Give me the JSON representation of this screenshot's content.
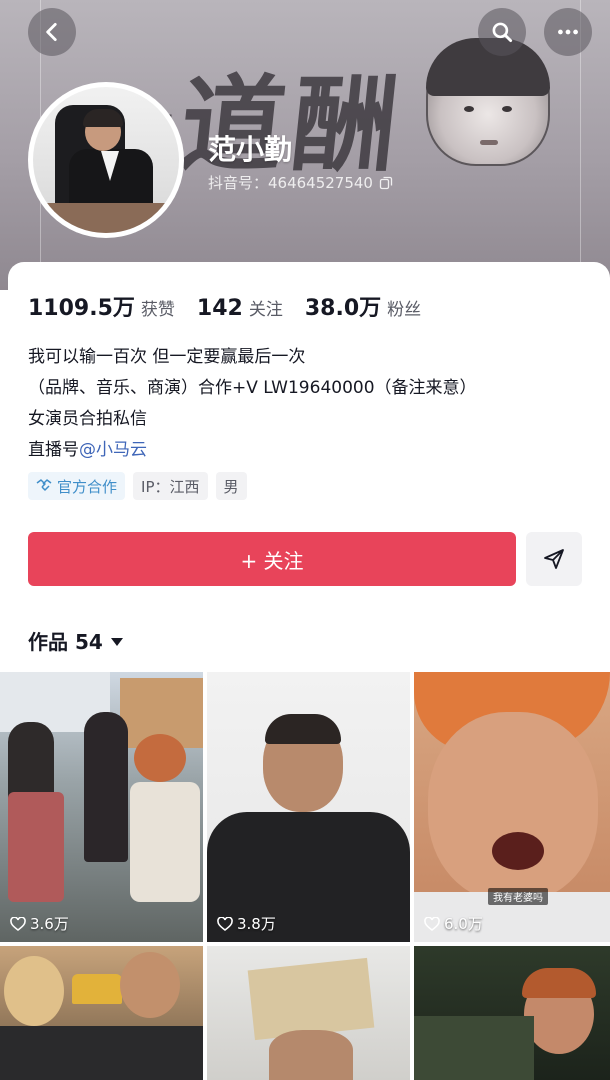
{
  "header": {
    "banner_text": "一道酬",
    "back_icon": "chevron-left-icon",
    "search_icon": "search-icon",
    "more_icon": "more-icon"
  },
  "profile": {
    "name": "范小勤",
    "douyin_id": "抖音号：46464527540"
  },
  "stats": [
    {
      "value": "1109.5万",
      "label": "获赞"
    },
    {
      "value": "142",
      "label": "关注"
    },
    {
      "value": "38.0万",
      "label": "粉丝"
    }
  ],
  "bio": {
    "line1": "我可以输一百次 但一定要赢最后一次",
    "line2": "（品牌、音乐、商演）合作+V   LW19640000（备注来意）",
    "line3": "女演员合拍私信",
    "line4_prefix": "直播号",
    "line4_mention": "@小马云"
  },
  "tags": {
    "official": "官方合作",
    "ip": "IP：江西",
    "gender": "男"
  },
  "actions": {
    "follow": "+ 关注"
  },
  "works": {
    "label": "作品 54"
  },
  "videos": [
    {
      "likes": "3.6万"
    },
    {
      "likes": "3.8万"
    },
    {
      "likes": "6.0万",
      "subtitle": "我有老婆吗"
    },
    {
      "likes": ""
    },
    {
      "likes": ""
    },
    {
      "likes": ""
    }
  ],
  "colors": {
    "accent": "#e8445a",
    "mention": "#3f66b8",
    "official_tag": "#3f8ec9"
  }
}
